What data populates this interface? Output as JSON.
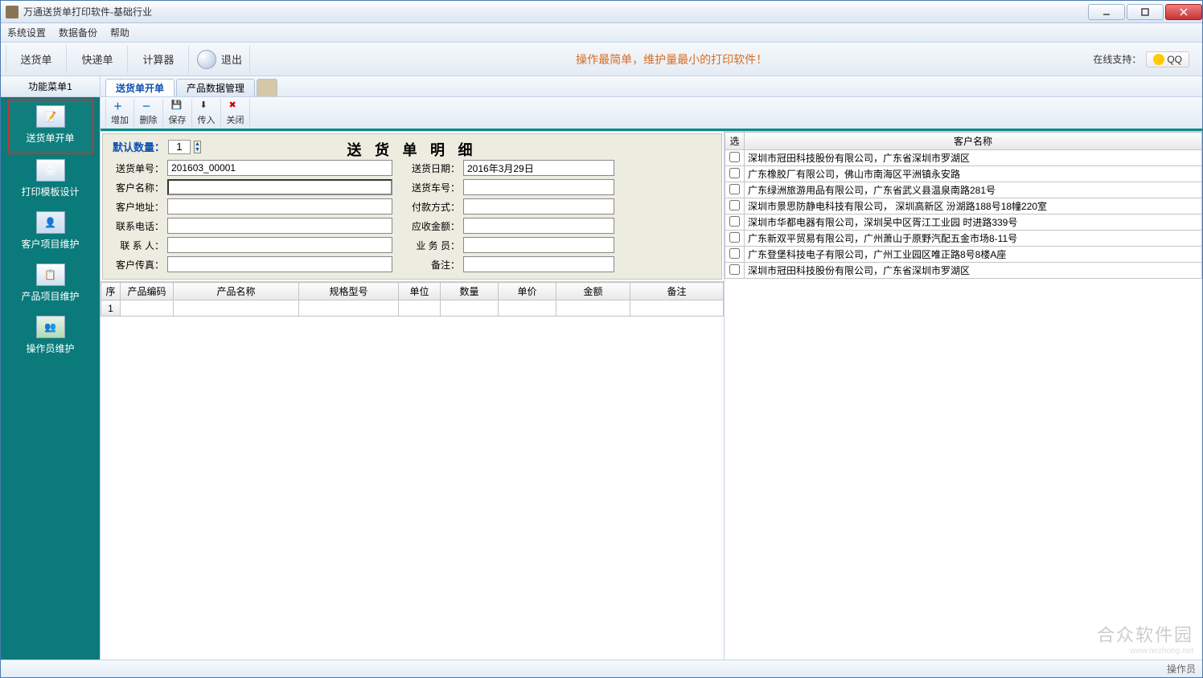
{
  "window": {
    "title": "万通送货单打印软件-基础行业"
  },
  "menubar": {
    "items": [
      "系统设置",
      "数据备份",
      "帮助"
    ]
  },
  "toolbar": {
    "buttons": [
      "送货单",
      "快递单",
      "计算器",
      "退出"
    ],
    "tagline": "操作最简单，维护量最小的打印软件！",
    "online_label": "在线支持：",
    "qq_label": "QQ"
  },
  "sidebar": {
    "header": "功能菜单1",
    "items": [
      "送货单开单",
      "打印模板设计",
      "客户项目维护",
      "产品项目维护",
      "操作员维护"
    ]
  },
  "tabs": {
    "items": [
      "送货单开单",
      "产品数据管理",
      ""
    ]
  },
  "subtoolbar": {
    "items": [
      "增加",
      "删除",
      "保存",
      "传入",
      "关闭"
    ]
  },
  "form": {
    "title": "送 货 单 明 细",
    "default_qty_label": "默认数量：",
    "default_qty_value": "1",
    "fields": {
      "order_no_label": "送货单号：",
      "order_no_value": "201603_00001",
      "date_label": "送货日期：",
      "date_value": "2016年3月29日",
      "cust_name_label": "客户名称：",
      "cust_name_value": "",
      "vehicle_label": "送货车号：",
      "vehicle_value": "",
      "cust_addr_label": "客户地址：",
      "cust_addr_value": "",
      "pay_label": "付款方式：",
      "pay_value": "",
      "phone_label": "联系电话：",
      "phone_value": "",
      "amount_label": "应收金额：",
      "amount_value": "",
      "contact_label": "联 系 人：",
      "contact_value": "",
      "clerk_label": "业 务 员：",
      "clerk_value": "",
      "fax_label": "客户传真：",
      "fax_value": "",
      "remark_label": "备注：",
      "remark_value": ""
    }
  },
  "grid": {
    "headers": [
      "序",
      "产品编码",
      "产品名称",
      "规格型号",
      "单位",
      "数量",
      "单价",
      "金额",
      "备注"
    ],
    "rows": [
      {
        "seq": "1"
      }
    ]
  },
  "customers": {
    "sel_header": "选",
    "name_header": "客户名称",
    "rows": [
      "深圳市冠田科技股份有限公司，广东省深圳市罗湖区",
      "广东橡胶厂有限公司，佛山市南海区平洲镇永安路",
      "广东绿洲旅游用品有限公司，广东省武义县温泉南路281号",
      "深圳市景思防静电科技有限公司， 深圳高新区 汾湖路188号18幢220室",
      "深圳市华都电器有限公司，深圳吴中区胥江工业园 时进路339号",
      "广东新双平贸易有限公司，广州萧山于原野汽配五金市场8-11号",
      "广东登堡科技电子有限公司，广州工业园区唯正路8号8楼A座",
      "深圳市冠田科技股份有限公司，广东省深圳市罗湖区"
    ]
  },
  "statusbar": {
    "text": "操作员"
  },
  "watermark": {
    "main": "合众软件园",
    "sub": "www.hezhong.net"
  }
}
